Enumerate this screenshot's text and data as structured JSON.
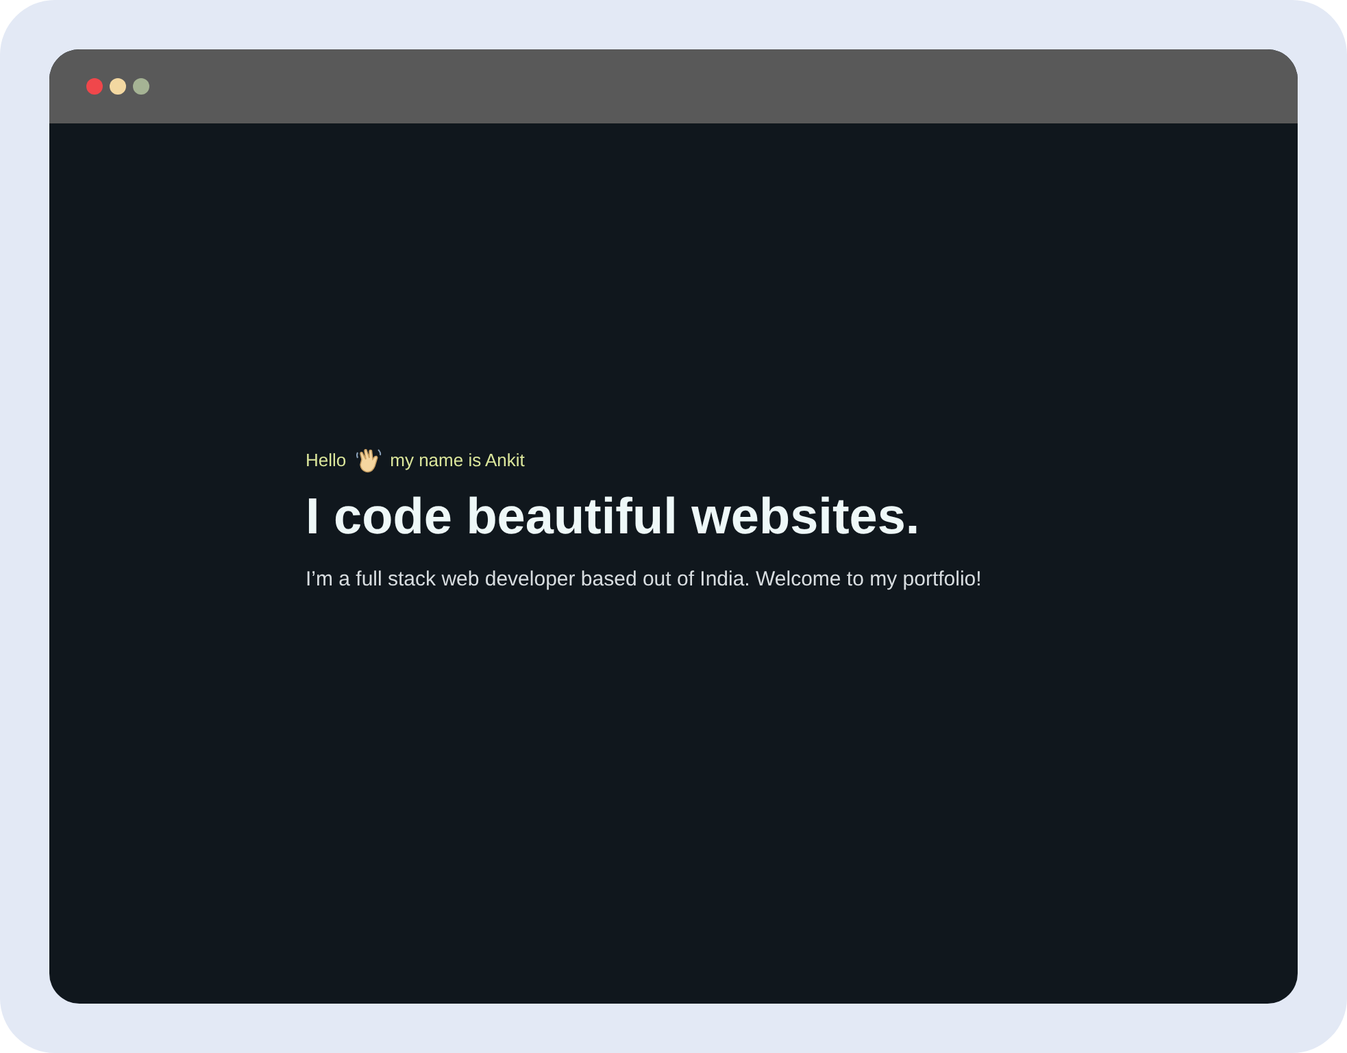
{
  "greeting": {
    "hello": "Hello",
    "name_line": "my name is Ankit"
  },
  "headline": "I code beautiful websites.",
  "intro": "I’m a full stack web developer based out of India. Welcome to my portfolio!"
}
